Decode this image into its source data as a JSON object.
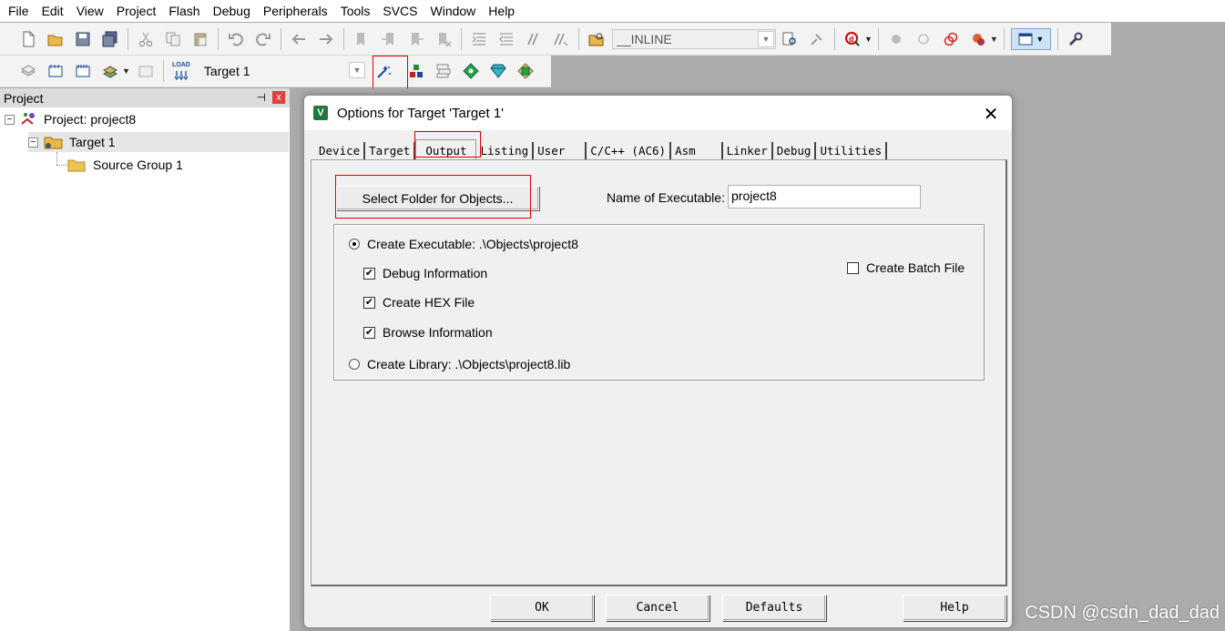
{
  "menu": [
    "File",
    "Edit",
    "View",
    "Project",
    "Flash",
    "Debug",
    "Peripherals",
    "Tools",
    "SVCS",
    "Window",
    "Help"
  ],
  "toolbar1": {
    "find_combo_value": "__INLINE"
  },
  "toolbar2": {
    "target_value": "Target 1",
    "load_icon_text": "LOAD"
  },
  "project_panel": {
    "title": "Project",
    "pin_glyph": "⊣",
    "close_glyph": "x",
    "tree": {
      "root": "Project: project8",
      "target": "Target 1",
      "group": "Source Group 1"
    },
    "expander_glyph": "−"
  },
  "dialog": {
    "icon_text": "V",
    "title": "Options for Target 'Target 1'",
    "close_glyph": "✕",
    "tabs": [
      "Device",
      "Target",
      "Output",
      "Listing",
      "User",
      "C/C++ (AC6)",
      "Asm",
      "Linker",
      "Debug",
      "Utilities"
    ],
    "active_tab": "Output",
    "select_folder_label": "Select Folder for Objects...",
    "name_exec_label": "Name of Executable:",
    "name_exec_value": "project8",
    "create_exec_label": "Create Executable:  .\\Objects\\project8",
    "debug_info_label": "Debug Information",
    "create_hex_label": "Create HEX File",
    "browse_info_label": "Browse Information",
    "create_batch_label": "Create Batch File",
    "create_lib_label": "Create Library:  .\\Objects\\project8.lib",
    "check_glyph": "✔",
    "buttons": {
      "ok": "OK",
      "cancel": "Cancel",
      "defaults": "Defaults",
      "help": "Help"
    }
  },
  "watermark": "CSDN @csdn_dad_dad",
  "colors": {
    "highlight_red": "#e00000",
    "app_icon_green": "#1f7a3a",
    "workspace_gray": "#ababab"
  }
}
